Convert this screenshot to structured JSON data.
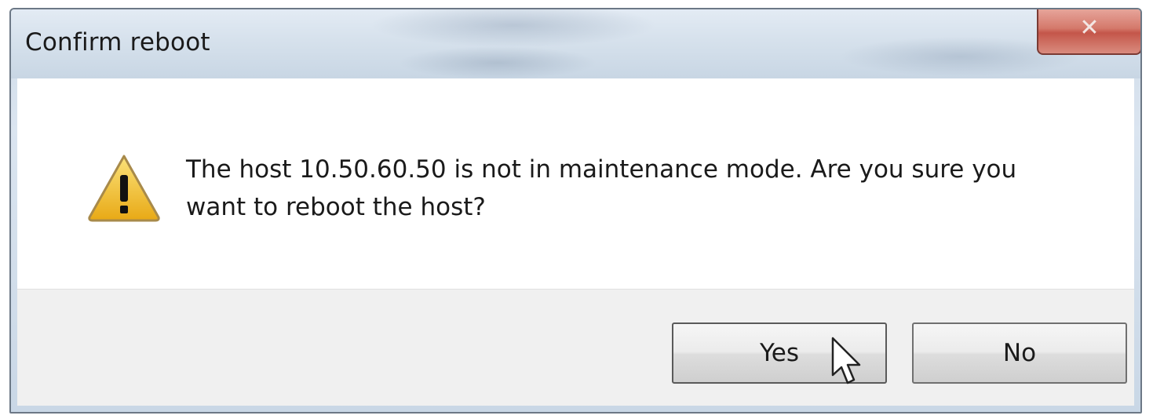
{
  "dialog": {
    "title": "Confirm reboot",
    "close_icon": "close-icon",
    "message_line1": "The host 10.50.60.50 is not in maintenance mode. Are you sure you",
    "message_line2": "want to reboot the host?",
    "warning_icon": "warning-icon"
  },
  "buttons": {
    "yes_label": "Yes",
    "no_label": "No"
  },
  "colors": {
    "titlebar": "#d6e1ec",
    "close_button": "#c4564a",
    "content_bg": "#ffffff",
    "footer_bg": "#f0f0f0",
    "warning_yellow": "#f2c12e"
  }
}
